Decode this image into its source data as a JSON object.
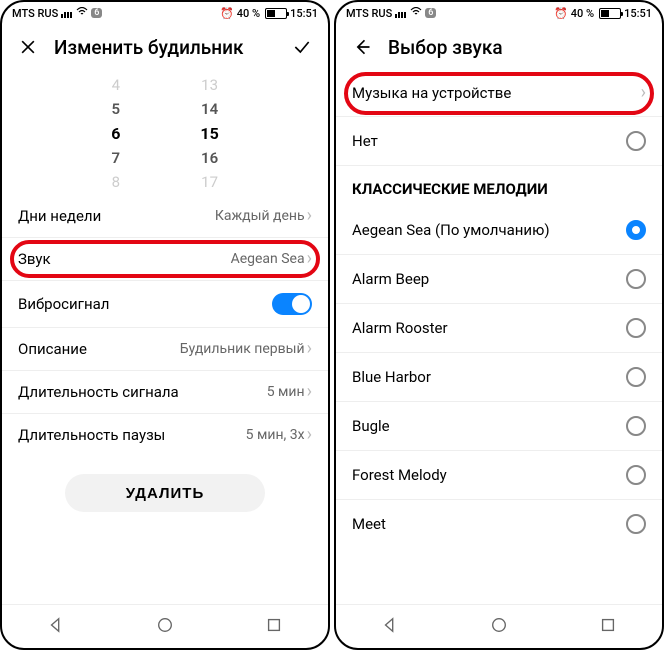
{
  "status": {
    "carrier": "MTS RUS",
    "notif_count": "6",
    "battery_pct": "40 %",
    "time": "15:51",
    "alarm_icon": "⏰"
  },
  "left": {
    "title": "Изменить будильник",
    "picker": {
      "hours": [
        "4",
        "5",
        "6",
        "7",
        "8"
      ],
      "minutes": [
        "13",
        "14",
        "15",
        "16",
        "17"
      ]
    },
    "rows": {
      "days_label": "Дни недели",
      "days_value": "Каждый день",
      "sound_label": "Звук",
      "sound_value": "Aegean Sea",
      "vibro_label": "Вибросигнал",
      "desc_label": "Описание",
      "desc_value": "Будильник первый",
      "signal_len_label": "Длительность сигнала",
      "signal_len_value": "5 мин",
      "pause_len_label": "Длительность паузы",
      "pause_len_value": "5 мин, 3x"
    },
    "delete_label": "УДАЛИТЬ"
  },
  "right": {
    "title": "Выбор звука",
    "music_row": "Музыка на устройстве",
    "none_label": "Нет",
    "section": "КЛАССИЧЕСКИЕ МЕЛОДИИ",
    "options": {
      "o0": "Aegean Sea (По умолчанию)",
      "o1": "Alarm Beep",
      "o2": "Alarm Rooster",
      "o3": "Blue Harbor",
      "o4": "Bugle",
      "o5": "Forest Melody",
      "o6": "Meet"
    }
  }
}
